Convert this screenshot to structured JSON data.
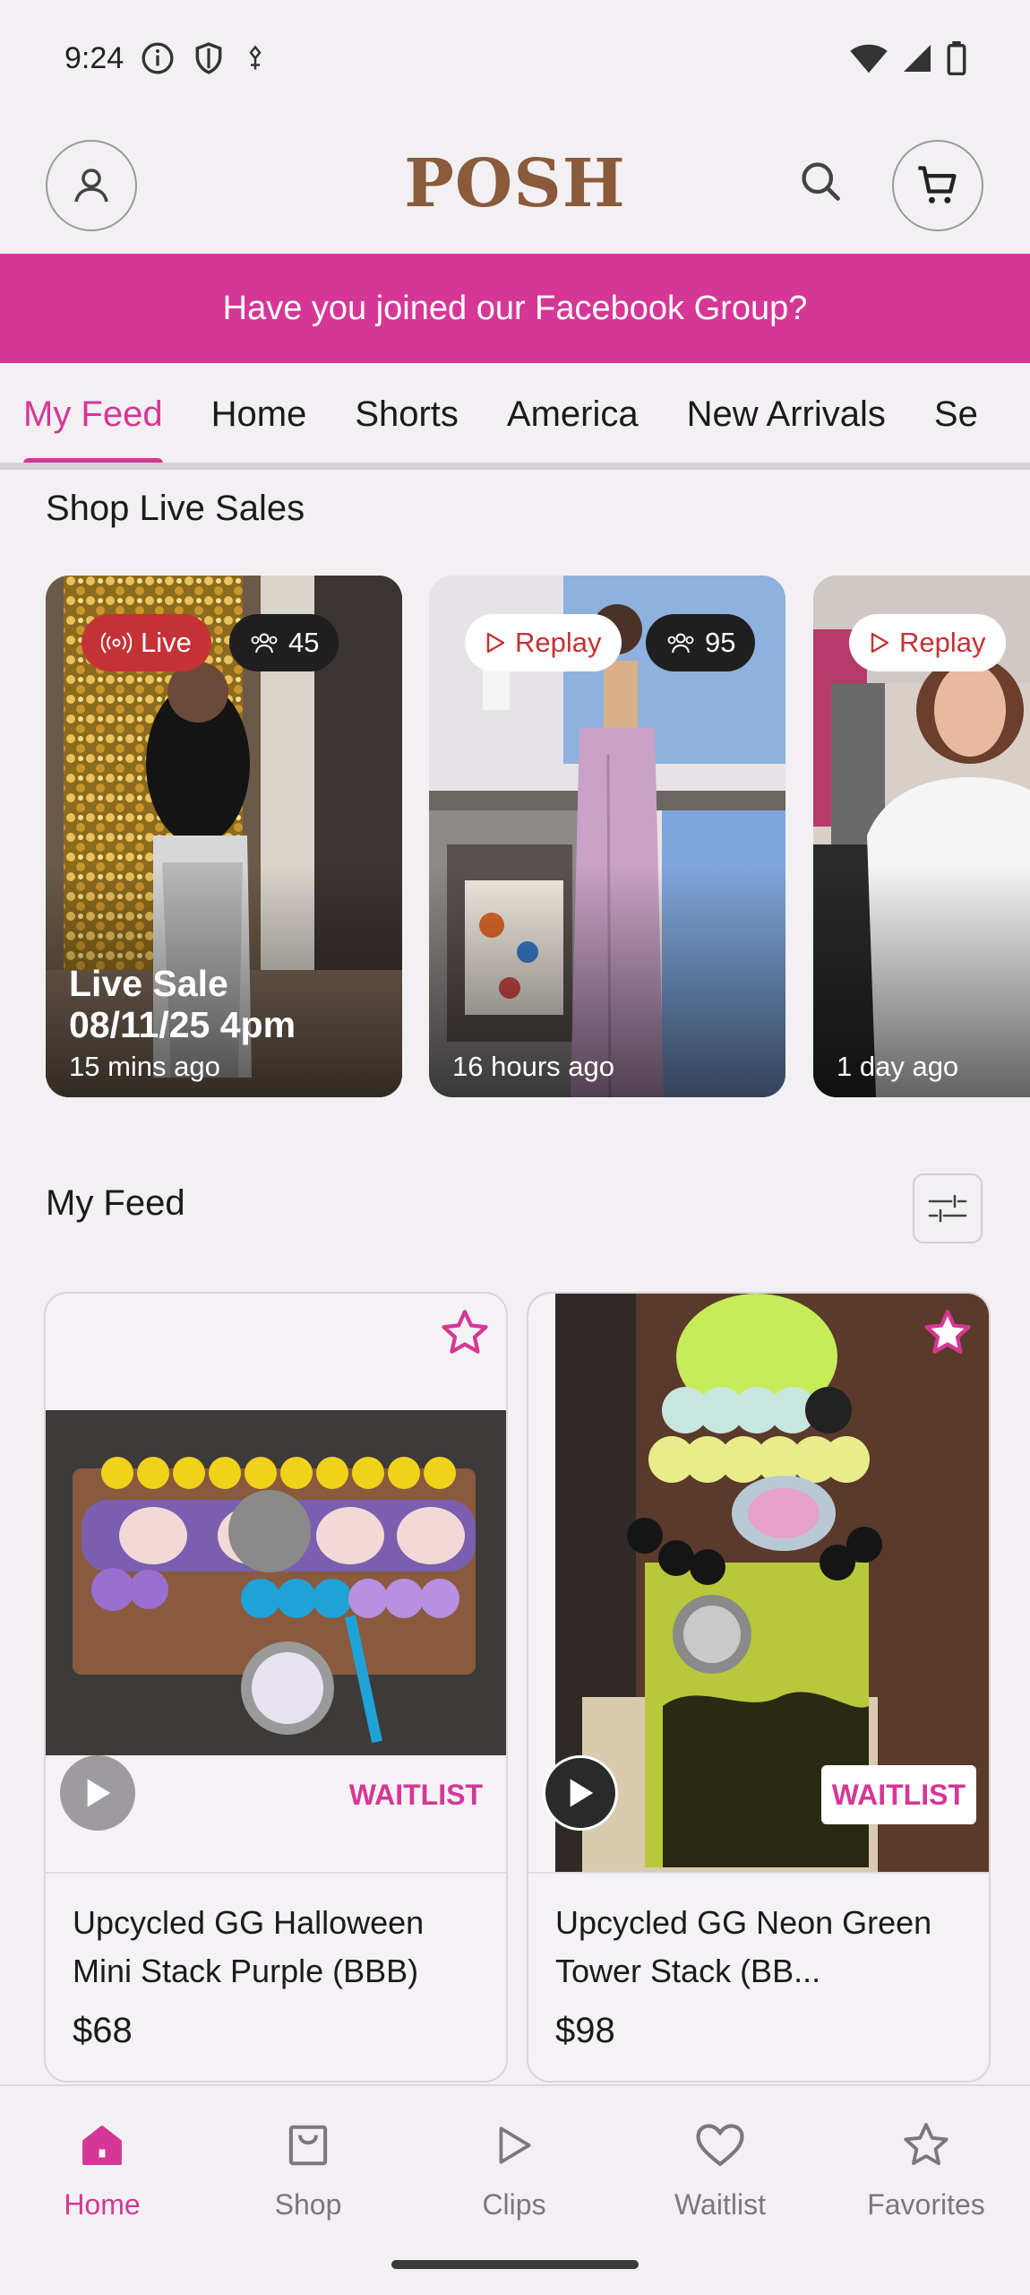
{
  "status_bar": {
    "time": "9:24"
  },
  "header": {
    "logo": "POSH"
  },
  "banner": {
    "text": "Have you joined our Facebook Group?"
  },
  "tabs": [
    {
      "label": "My Feed"
    },
    {
      "label": "Home"
    },
    {
      "label": "Shorts"
    },
    {
      "label": "America"
    },
    {
      "label": "New Arrivals"
    },
    {
      "label": "Se"
    }
  ],
  "live_sales": {
    "title": "Shop Live Sales",
    "cards": [
      {
        "badge": "Live",
        "viewers": "45",
        "title_line1": "Live Sale",
        "title_line2": "08/11/25 4pm",
        "time": "15 mins ago"
      },
      {
        "badge": "Replay",
        "viewers": "95",
        "time": "16 hours ago"
      },
      {
        "badge": "Replay",
        "time": "1 day ago"
      }
    ]
  },
  "feed": {
    "title": "My Feed",
    "products": [
      {
        "name": "Upcycled GG Halloween Mini Stack Purple (BBB)",
        "price": "$68",
        "status": "WAITLIST"
      },
      {
        "name": "Upcycled GG Neon Green Tower Stack (BB...",
        "price": "$98",
        "status": "WAITLIST"
      }
    ]
  },
  "bottom_nav": [
    {
      "label": "Home",
      "icon": "home-icon"
    },
    {
      "label": "Shop",
      "icon": "shopping-bag-icon"
    },
    {
      "label": "Clips",
      "icon": "play-icon"
    },
    {
      "label": "Waitlist",
      "icon": "heart-icon"
    },
    {
      "label": "Favorites",
      "icon": "star-icon"
    }
  ],
  "colors": {
    "brand_pink": "#D63796",
    "live_red": "#C53236"
  }
}
